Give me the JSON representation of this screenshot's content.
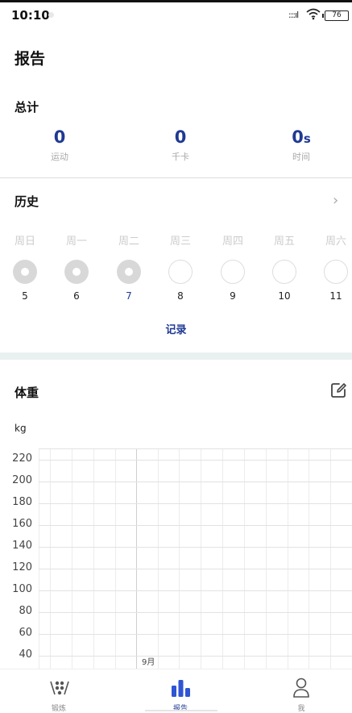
{
  "status": {
    "time": "10:10",
    "signal": ":::ıl",
    "battery": "76"
  },
  "page_title": "报告",
  "summary": {
    "title": "总计",
    "stats": [
      {
        "value": "0",
        "unit": "",
        "label": "运动"
      },
      {
        "value": "0",
        "unit": "",
        "label": "千卡"
      },
      {
        "value": "0",
        "unit": "s",
        "label": "时间"
      }
    ]
  },
  "history": {
    "title": "历史",
    "weekdays": [
      "周日",
      "周一",
      "周二",
      "周三",
      "周四",
      "周五",
      "周六"
    ],
    "days": [
      {
        "num": "5",
        "done": true
      },
      {
        "num": "6",
        "done": true
      },
      {
        "num": "7",
        "done": true,
        "today": true
      },
      {
        "num": "8",
        "done": false
      },
      {
        "num": "9",
        "done": false
      },
      {
        "num": "10",
        "done": false
      },
      {
        "num": "11",
        "done": false
      }
    ],
    "record_label": "记录"
  },
  "weight": {
    "title": "体重",
    "unit": "kg",
    "y_labels": [
      "220",
      "200",
      "180",
      "160",
      "140",
      "120",
      "100",
      "80",
      "60",
      "40"
    ],
    "month_label": "9月"
  },
  "tabs": [
    {
      "label": "锻炼",
      "icon": "workout-icon",
      "active": false
    },
    {
      "label": "报告",
      "icon": "report-chart-icon",
      "active": true
    },
    {
      "label": "我",
      "icon": "profile-icon",
      "active": false
    }
  ]
}
